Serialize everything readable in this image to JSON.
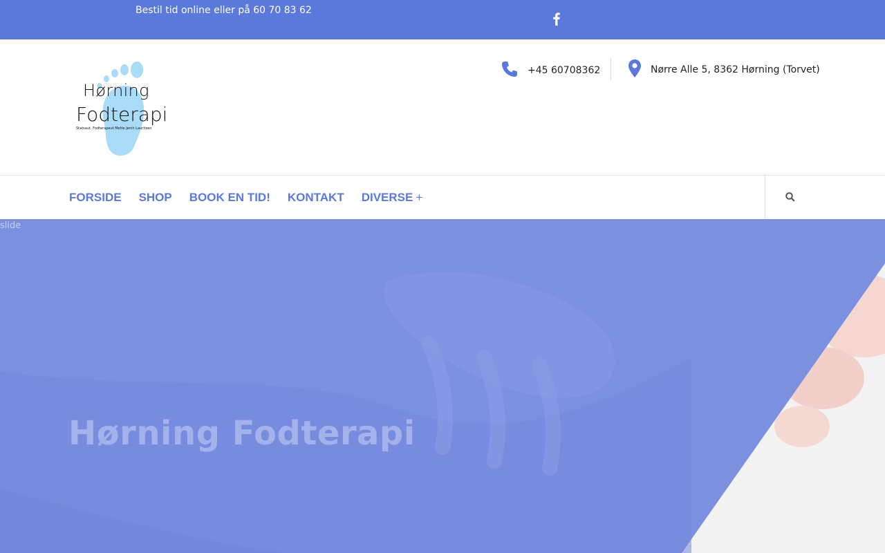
{
  "topbar": {
    "text": "Bestil tid online eller på 60 70 83 62",
    "social_icon": "facebook-icon"
  },
  "logo": {
    "line1": "Hørning",
    "line2": "Fodterapi",
    "subtitle": "Statsaut. Fodterapeut Mette Jørch Lauritzen"
  },
  "header": {
    "phone": "+45 60708362",
    "phone_icon": "phone-icon",
    "address": "Nørre Alle 5, 8362 Hørning (Torvet)",
    "address_icon": "map-pin-icon"
  },
  "nav": {
    "items": [
      {
        "label": "FORSIDE"
      },
      {
        "label": "SHOP"
      },
      {
        "label": "BOOK EN TID!"
      },
      {
        "label": "KONTAKT"
      },
      {
        "label": "DIVERSE",
        "submenu_marker": "+"
      }
    ],
    "search_icon": "search-icon"
  },
  "hero": {
    "image_alt": "slide",
    "title": "Hørning Fodterapi"
  },
  "colors": {
    "accent": "#5b79db",
    "hero_overlay": "#7b91e0",
    "hero_title": "#a4b2ec"
  }
}
